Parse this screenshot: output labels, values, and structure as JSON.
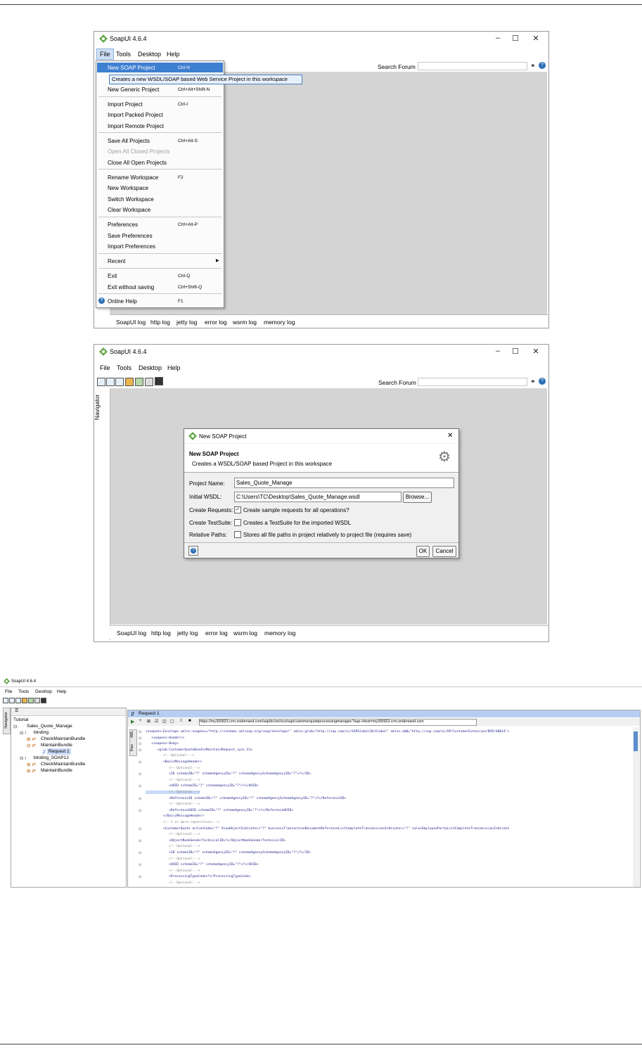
{
  "screen1": {
    "title": "SoapUI 4.6.4",
    "menubar": [
      "File",
      "Tools",
      "Desktop",
      "Help"
    ],
    "search_label": "Search Forum",
    "file_menu": [
      {
        "label": "New SOAP Project",
        "shortcut": "Ctrl-N"
      },
      {
        "label": "New Generic Project",
        "shortcut": "Ctrl+Alt+Shift-N"
      },
      {
        "label": "Import Project",
        "shortcut": "Ctrl-I"
      },
      {
        "label": "Import Packed Project",
        "shortcut": ""
      },
      {
        "label": "Import Remote Project",
        "shortcut": ""
      },
      {
        "label": "Save All Projects",
        "shortcut": "Ctrl+Alt-S"
      },
      {
        "label": "Open All Closed Projects",
        "shortcut": ""
      },
      {
        "label": "Close All Open Projects",
        "shortcut": ""
      },
      {
        "label": "Rename Workspace",
        "shortcut": "F2"
      },
      {
        "label": "New Workspace",
        "shortcut": ""
      },
      {
        "label": "Switch Workspace",
        "shortcut": ""
      },
      {
        "label": "Clear Workspace",
        "shortcut": ""
      },
      {
        "label": "Preferences",
        "shortcut": "Ctrl+Alt-P"
      },
      {
        "label": "Save Preferences",
        "shortcut": ""
      },
      {
        "label": "Import Preferences",
        "shortcut": ""
      },
      {
        "label": "Recent",
        "shortcut": ""
      },
      {
        "label": "Exit",
        "shortcut": "Ctrl-Q"
      },
      {
        "label": "Exit without saving",
        "shortcut": "Ctrl+Shift-Q"
      },
      {
        "label": "Online Help",
        "shortcut": "F1"
      }
    ],
    "tooltip": "Creates a new WSDL/SOAP based Web Service Project in this workspace",
    "logs": [
      "SoapUI log",
      "http log",
      "jetty log",
      "error log",
      "wsrm log",
      "memory log"
    ]
  },
  "screen2": {
    "title": "SoapUI 4.6.4",
    "menubar": [
      "File",
      "Tools",
      "Desktop",
      "Help"
    ],
    "search_label": "Search Forum",
    "navigator_label": "Navigator",
    "dialog": {
      "title": "New SOAP Project",
      "heading": "New SOAP Project",
      "subheading": "Creates a WSDL/SOAP based Project in this workspace",
      "project_name_label": "Project Name:",
      "project_name_value": "Sales_Quote_Manage",
      "initial_wsdl_label": "Initial WSDL:",
      "initial_wsdl_value": "C:\\Users\\TC\\Desktop\\Sales_Quote_Manage.wsdl",
      "browse_label": "Browse...",
      "create_requests_label": "Create Requests:",
      "create_requests_text": "Create sample requests for all operations?",
      "create_requests_checked": true,
      "create_testsuite_label": "Create TestSuite:",
      "create_testsuite_text": "Creates a TestSuite for the imported WSDL",
      "relative_paths_label": "Relative Paths:",
      "relative_paths_text": "Stores all file paths in project relatively to project file (requires save)",
      "ok_label": "OK",
      "cancel_label": "Cancel"
    },
    "logs": [
      "SoapUI log",
      "http log",
      "jetty log",
      "error log",
      "wsrm log",
      "memory log"
    ]
  },
  "screen3": {
    "title": "SoapUI 4.6.4",
    "menubar": [
      "File",
      "Tools",
      "Desktop",
      "Help"
    ],
    "navigator_label": "Navigator",
    "tree": [
      "Tutorial",
      "Sales_Quote_Manage",
      "binding",
      "CheckMaintainBundle",
      "MaintainBundle",
      "Request 1",
      "binding_SOAP12",
      "CheckMaintainBundle",
      "MaintainBundle"
    ],
    "request_tab": "Request 1",
    "raw_label": "Raw",
    "xml_label": "XML",
    "endpoint": "https://my300923.crm.ondemand.com/sap/bc/srt/scs/sap/customerquoteprocessingmanagec?sap-vhost=my300923.crm.ondemand.com",
    "xml_lines": [
      "<soapenv:Envelope xmlns:soapenv=\"http://schemas.xmlsoap.org/soap/envelope/\" xmlns:glob=\"http://sap.com/xi/SAPGlobal20/Global\" xmlns:a00=\"http://sap.com/xi/AP/CustomerExtension/BYD/A0014\">",
      "   <soapenv:Header/>",
      "   <soapenv:Body>",
      "      <glob:CustomerQuoteBundleMaintainRequest_sync_V1>",
      "         <!--Optional:-->",
      "         <BasicMessageHeader>",
      "            <!--Optional:-->",
      "            <ID schemeID=\"?\" schemeAgencyID=\"?\" schemeAgencySchemeAgencyID=\"?\">?</ID>",
      "            <!--Optional:-->",
      "            <UUID schemeID=\"?\" schemeAgencyID=\"?\">?</UUID>",
      "            <!--Optional:-->",
      "            <ReferenceID schemeID=\"?\" schemeAgencyID=\"?\" schemeAgencySchemeAgencyID=\"?\">?</ReferenceID>",
      "            <!--Optional:-->",
      "            <ReferenceUUID schemeID=\"?\" schemeAgencyID=\"?\">?</ReferenceUUID>",
      "         </BasicMessageHeader>",
      "         <!--1 or more repetitions:-->",
      "         <CustomerQuote actionCode=\"?\" ViewObjectIndicator=\"?\" businessTransactionDocumentReferenceListCompleteTransmissionIndicator=\"?\" salesEmployeePartyListCompleteTransmissionIndicato",
      "            <!--Optional:-->",
      "            <ObjectNodeSenderTechnicalID>?</ObjectNodeSenderTechnicalID>",
      "            <!--Optional:-->",
      "            <ID schemeID=\"?\" schemeAgencyID=\"?\" schemeAgencySchemeAgencyID=\"?\">?</ID>",
      "            <!--Optional:-->",
      "            <UUID schemeID=\"?\" schemeAgencyID=\"?\">?</UUID>",
      "            <!--Optional:-->",
      "            <ProcessingTypeCode>?</ProcessingTypeCode>",
      "            <!--Optional:-->"
    ]
  }
}
